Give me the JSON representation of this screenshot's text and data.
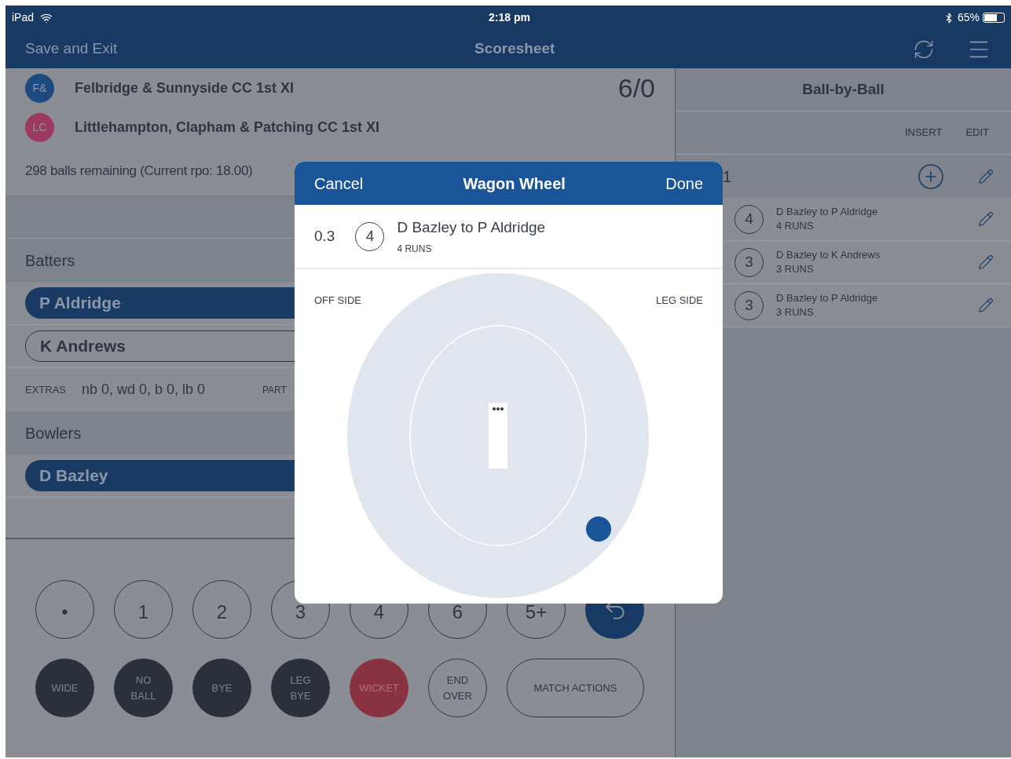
{
  "status_bar": {
    "device": "iPad",
    "time": "2:18 pm",
    "battery": "65%"
  },
  "nav": {
    "left": "Save and Exit",
    "title": "Scoresheet"
  },
  "teams": [
    {
      "badge": "F&",
      "name": "Felbridge & Sunnyside CC 1st XI",
      "color": "#1e4a80",
      "score": "6/0"
    },
    {
      "badge": "LC",
      "name": "Littlehampton, Clapham & Patching CC 1st XI",
      "color": "#9b3a5c"
    }
  ],
  "balls_remaining": "298 balls remaining (Current rpo: 18.00)",
  "batters": {
    "title": "Batters",
    "items": [
      {
        "name": "P Aldridge",
        "selected": true
      },
      {
        "name": "K Andrews",
        "selected": false
      }
    ]
  },
  "extras": {
    "label": "EXTRAS",
    "value": "nb 0, wd 0, b 0, lb 0",
    "partnership_label": "PART"
  },
  "bowlers": {
    "title": "Bowlers",
    "items": [
      {
        "name": "D Bazley",
        "selected": true
      }
    ]
  },
  "run_buttons": [
    {
      "label": "•",
      "kind": "outline"
    },
    {
      "label": "1",
      "kind": "outline"
    },
    {
      "label": "2",
      "kind": "outline"
    },
    {
      "label": "3",
      "kind": "outline"
    },
    {
      "label": "4",
      "kind": "outline"
    },
    {
      "label": "6",
      "kind": "outline"
    },
    {
      "label": "5+",
      "kind": "outline"
    },
    {
      "kind": "undo"
    }
  ],
  "action_buttons": [
    {
      "label": "WIDE",
      "kind": "filled"
    },
    {
      "label": "NO\nBALL",
      "kind": "filled"
    },
    {
      "label": "BYE",
      "kind": "filled"
    },
    {
      "label": "LEG\nBYE",
      "kind": "filled"
    },
    {
      "label": "WICKET",
      "kind": "danger"
    },
    {
      "label": "END\nOVER",
      "kind": "outline"
    },
    {
      "label": "MATCH ACTIONS",
      "kind": "wide"
    }
  ],
  "ball_by_ball": {
    "title": "Ball-by-Ball",
    "columns": [
      "INSERT",
      "EDIT"
    ],
    "over_label": "1",
    "balls": [
      {
        "runs": "4",
        "description": "D Bazley to P Aldridge",
        "detail": "4 RUNS"
      },
      {
        "runs": "3",
        "description": "D Bazley to K Andrews",
        "detail": "3 RUNS"
      },
      {
        "runs": "3",
        "description": "D Bazley to P Aldridge",
        "detail": "3 RUNS"
      }
    ]
  },
  "modal": {
    "cancel": "Cancel",
    "title": "Wagon Wheel",
    "done": "Done",
    "over": "0.3",
    "runs": "4",
    "description": "D Bazley to P Aldridge",
    "detail": "4 RUNS",
    "off_side": "OFF SIDE",
    "leg_side": "LEG SIDE"
  }
}
